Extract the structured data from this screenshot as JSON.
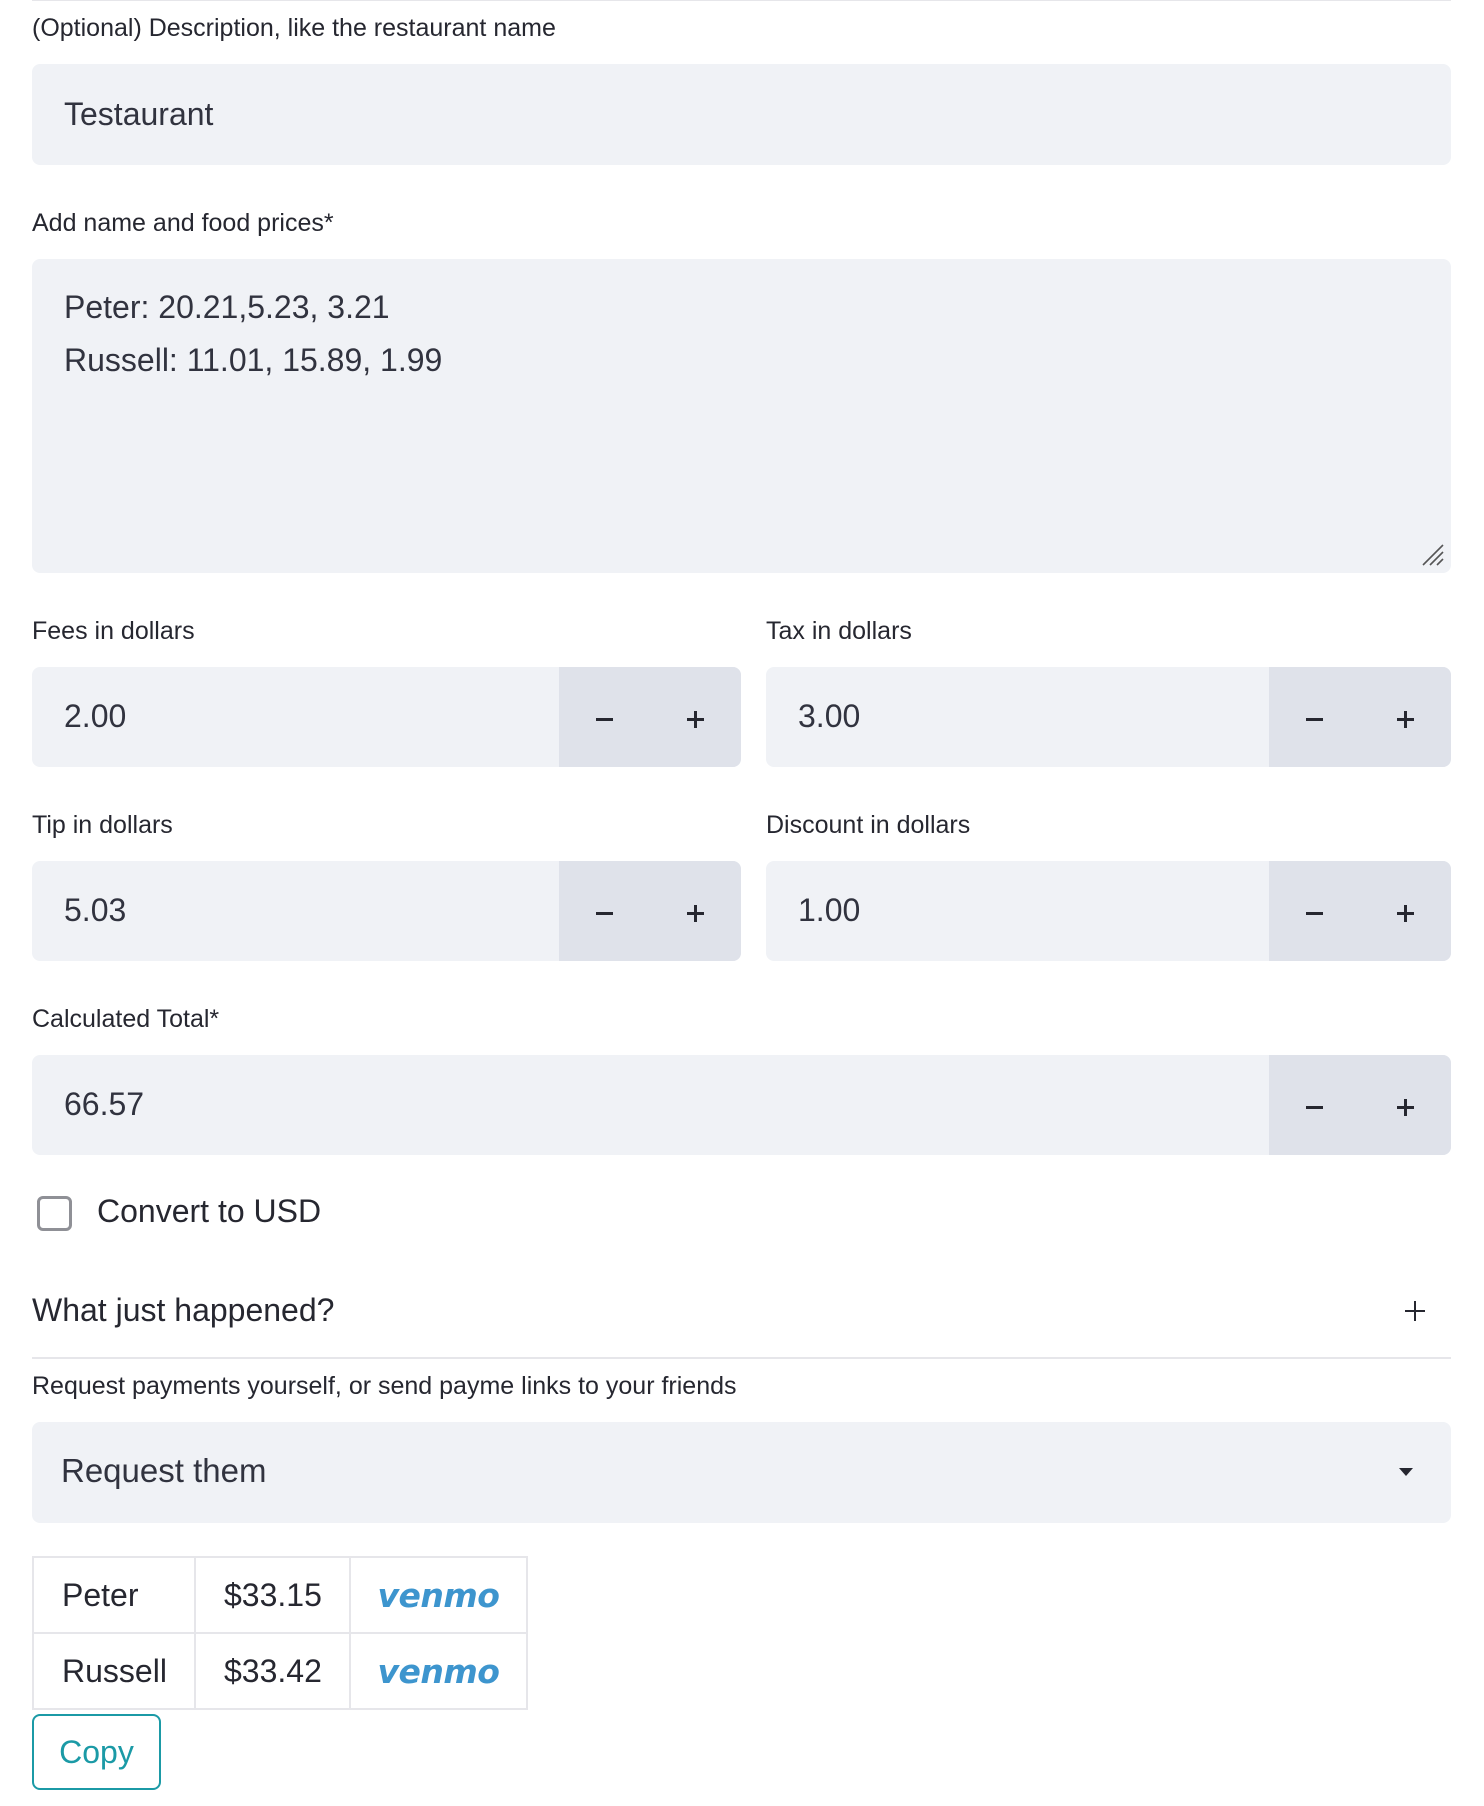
{
  "description": {
    "label": "(Optional) Description, like the restaurant name",
    "value": "Testaurant"
  },
  "items": {
    "label": "Add name and food prices*",
    "lines": [
      "Peter: 20.21,5.23, 3.21",
      "Russell: 11.01, 15.89, 1.99"
    ]
  },
  "fees": {
    "label": "Fees in dollars",
    "value": "2.00"
  },
  "tax": {
    "label": "Tax in dollars",
    "value": "3.00"
  },
  "tip": {
    "label": "Tip in dollars",
    "value": "5.03"
  },
  "discount": {
    "label": "Discount in dollars",
    "value": "1.00"
  },
  "total": {
    "label": "Calculated Total*",
    "value": "66.57"
  },
  "convert": {
    "label": "Convert to USD",
    "checked": false
  },
  "expander": {
    "title": "What just happened?",
    "icon": "plus-icon"
  },
  "request": {
    "label": "Request payments yourself, or send payme links to your friends",
    "selected": "Request them"
  },
  "payments": [
    {
      "name": "Peter",
      "amount": "$33.15",
      "service": "venmo"
    },
    {
      "name": "Russell",
      "amount": "$33.42",
      "service": "venmo"
    }
  ],
  "copy_label": "Copy",
  "colors": {
    "field_bg": "#f0f2f6",
    "stepper_bg": "#dfe2ea",
    "venmo_blue": "#3d95ce",
    "copy_teal": "#1b9aa6"
  }
}
